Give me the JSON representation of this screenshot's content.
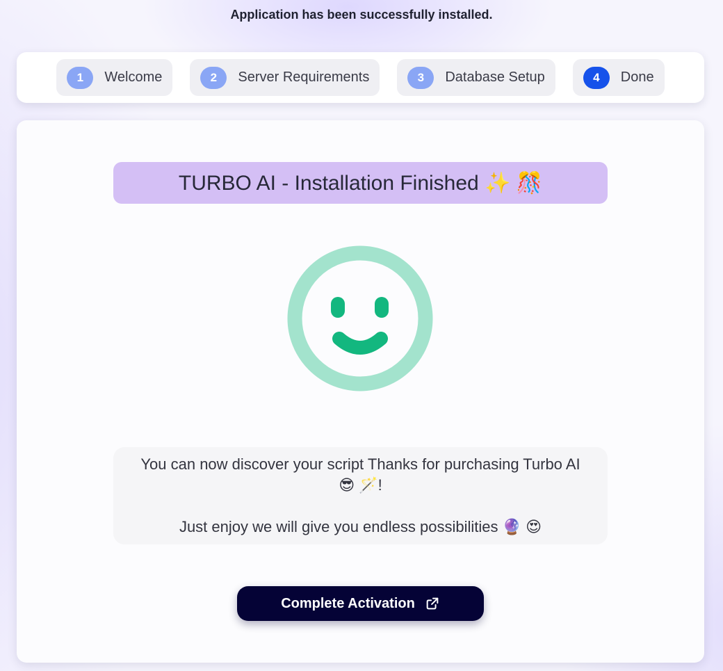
{
  "status_message": "Application has been successfully installed.",
  "steps": [
    {
      "number": "1",
      "label": "Welcome"
    },
    {
      "number": "2",
      "label": "Server Requirements"
    },
    {
      "number": "3",
      "label": "Database Setup"
    },
    {
      "number": "4",
      "label": "Done"
    }
  ],
  "active_step": "4",
  "main": {
    "title": "TURBO AI - Installation Finished ✨ 🎊",
    "message_line1": "You can now discover your script Thanks for purchasing Turbo AI",
    "message_line2": "😎 🪄!",
    "message_line3": "Just enjoy we will give you endless possibilities 🔮 😍",
    "button_label": "Complete Activation",
    "button_icon": "external-link-icon",
    "status_icon": "smiley-face-icon"
  },
  "colors": {
    "primary": "#1652ea",
    "step_badge": "#8aa6f5",
    "banner": "#d4bff5",
    "smiley_ring": "#a3e3cd",
    "smiley_face": "#13b77f",
    "button": "#050336"
  }
}
